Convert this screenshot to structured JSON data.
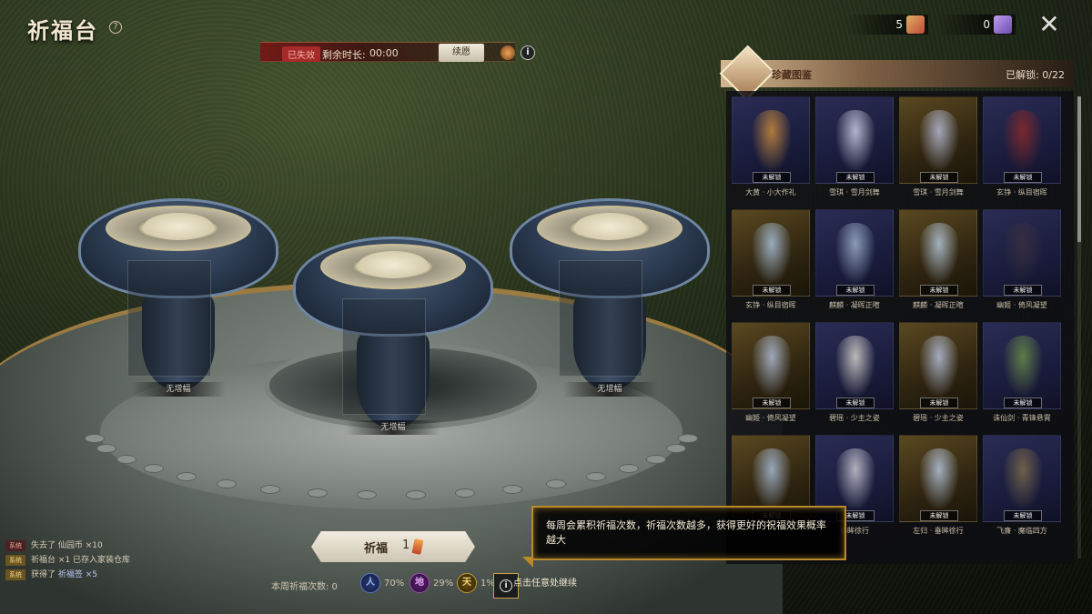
{
  "title": "祈福台",
  "help": "?",
  "timer": {
    "status": "已失效",
    "label": "剩余时长:",
    "value": "00:00",
    "renew_label": "续愿"
  },
  "currency": [
    {
      "amount": "5",
      "icon": "fu-token-icon",
      "color": "#c04a3a"
    },
    {
      "amount": "0",
      "icon": "purple-token-icon",
      "color": "#6a4ab0"
    }
  ],
  "close": "✕",
  "panel": {
    "title": "珍藏图鉴",
    "unlocked": "已解锁: 0/22",
    "locked_tag": "未解锁",
    "cards": [
      {
        "name": "大黄 · 小大作礼",
        "bg": "blue",
        "fig": "#c98b3c"
      },
      {
        "name": "雪琪 · 雪月剑舞",
        "bg": "blue",
        "fig": "#cfcfe4"
      },
      {
        "name": "雪琪 · 雪月剑舞",
        "bg": "gold",
        "fig": "#b8bdd8"
      },
      {
        "name": "玄铮 · 纵目宿晖",
        "bg": "blue",
        "fig": "#8a2a2a"
      },
      {
        "name": "玄铮 · 纵目宿晖",
        "bg": "gold",
        "fig": "#a9c2dc"
      },
      {
        "name": "麒麟 · 凝晖正暄",
        "bg": "blue",
        "fig": "#9fb0cc"
      },
      {
        "name": "麒麟 · 凝晖正暄",
        "bg": "gold",
        "fig": "#b6c8dc"
      },
      {
        "name": "幽姬 · 倚风凝望",
        "bg": "blue",
        "fig": "#3a3040"
      },
      {
        "name": "幽姬 · 倚风凝望",
        "bg": "gold",
        "fig": "#b0bdd8"
      },
      {
        "name": "碧瑶 · 少主之姿",
        "bg": "blue",
        "fig": "#d8d4cc"
      },
      {
        "name": "碧瑶 · 少主之姿",
        "bg": "gold",
        "fig": "#b6c2dc"
      },
      {
        "name": "诛仙剑 · 青锋悬霄",
        "bg": "blue",
        "fig": "#6a8a4a"
      },
      {
        "name": "",
        "bg": "gold",
        "fig": "#a8bcd8"
      },
      {
        "name": "垂眸徐行",
        "bg": "blue",
        "fig": "#c9c9d4"
      },
      {
        "name": "左归 · 垂眸徐行",
        "bg": "gold",
        "fig": "#b6c6de"
      },
      {
        "name": "飞廉 · 魔临四方",
        "bg": "blue",
        "fig": "#7a6a4a"
      }
    ]
  },
  "altar": {
    "slot_label": "无增幅"
  },
  "pray": {
    "label": "祈福",
    "count": "1"
  },
  "weekly": "本周祈福次数: 0",
  "tiers": [
    {
      "glyph": "人",
      "pct": "70%",
      "color": "#5a78c8"
    },
    {
      "glyph": "地",
      "pct": "29%",
      "color": "#a04ab0"
    },
    {
      "glyph": "天",
      "pct": "1%",
      "color": "#c89a30"
    }
  ],
  "info": "i",
  "tap_continue": "点击任意处继续",
  "tooltip": "每周会累积祈福次数，祈福次数越多，获得更好的祝福效果概率越大",
  "chat": [
    {
      "tag": "系统",
      "kind": "lost",
      "text": "失去了 仙园币 ×10",
      "hl": ""
    },
    {
      "tag": "系统",
      "kind": "sys",
      "text": "祈福台 ×1 已存入家装仓库",
      "hl": ""
    },
    {
      "tag": "系统",
      "kind": "sys",
      "text": "获得了 ",
      "hl": "祈福签 ×5"
    }
  ]
}
